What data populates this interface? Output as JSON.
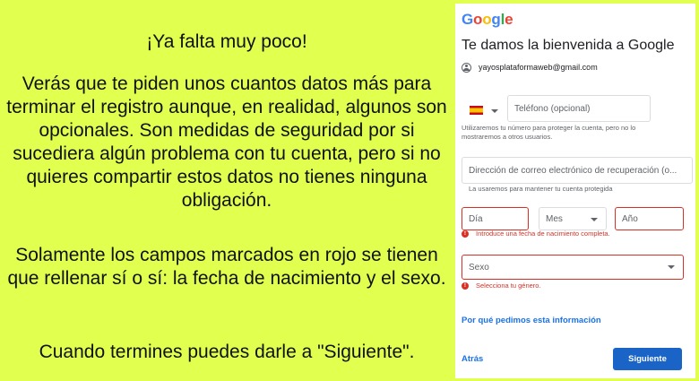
{
  "instructions": {
    "heading": "¡Ya falta muy poco!",
    "paragraph1": "Verás que te piden unos cuantos datos más para terminar el registro aunque, en realidad, algunos son opcionales. Son medidas de seguridad por si sucediera algún problema con tu cuenta, pero si no quieres compartir estos datos no tienes ninguna obligación.",
    "paragraph2": "Solamente los campos marcados en rojo se tienen que rellenar sí o sí: la fecha de nacimiento y el sexo.",
    "paragraph3": "Cuando termines puedes darle a \"Siguiente\"."
  },
  "form": {
    "logo": [
      "G",
      "o",
      "o",
      "g",
      "l",
      "e"
    ],
    "logo_colors": [
      "#4285f4",
      "#ea4335",
      "#fbbc05",
      "#4285f4",
      "#34a853",
      "#ea4335"
    ],
    "title": "Te damos la bienvenida a Google",
    "account_email": "yayosplataformaweb@gmail.com",
    "country_flag": "spain-flag",
    "phone_placeholder": "Teléfono (opcional)",
    "phone_hint": "Utilizaremos tu número para proteger la cuenta, pero no lo mostraremos a otros usuarios.",
    "recovery_placeholder": "Dirección de correo electrónico de recuperación (o...",
    "recovery_hint": "La usaremos para mantener tu cuenta protegida",
    "day_placeholder": "Día",
    "month_placeholder": "Mes",
    "year_placeholder": "Año",
    "birthdate_error": "Introduce una fecha de nacimiento completa.",
    "gender_placeholder": "Sexo",
    "gender_error": "Selecciona tu género.",
    "why_link": "Por qué pedimos esta información",
    "back_label": "Atrás",
    "next_label": "Siguiente",
    "error_icon_glyph": "!",
    "colors": {
      "background": "#e0ff4f",
      "error": "#d93025",
      "link": "#1a73e8",
      "primary_button": "#1a64c8"
    }
  }
}
